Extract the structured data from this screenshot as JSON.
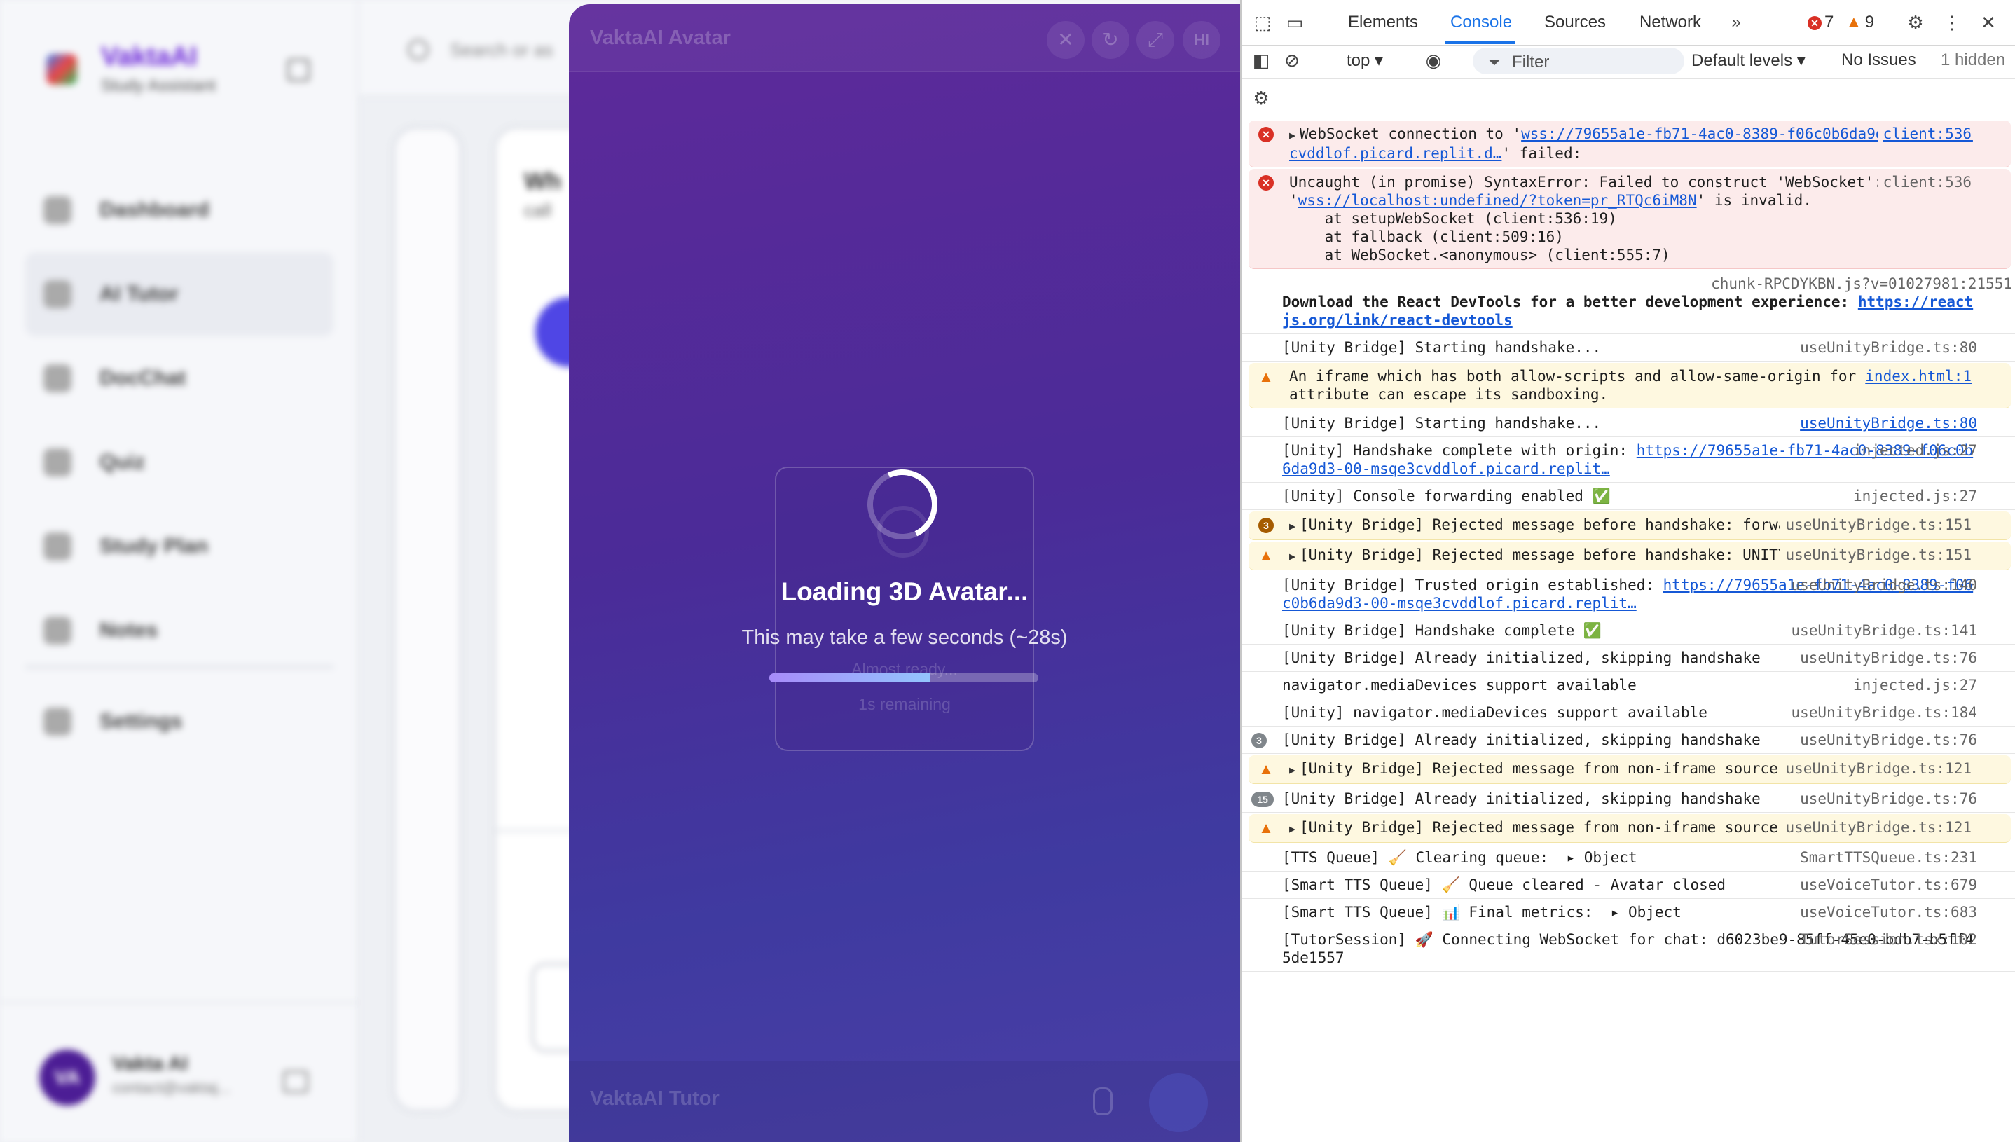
{
  "app": {
    "brand_name": "VaktaAI",
    "brand_sub": "Study Assistant",
    "nav": [
      {
        "label": "Dashboard",
        "icon": "home-icon"
      },
      {
        "label": "AI Tutor",
        "icon": "graduation-cap-icon"
      },
      {
        "label": "DocChat",
        "icon": "document-icon"
      },
      {
        "label": "Quiz",
        "icon": "quiz-icon"
      },
      {
        "label": "Study Plan",
        "icon": "calendar-icon"
      },
      {
        "label": "Notes",
        "icon": "notes-icon"
      }
    ],
    "settings_label": "Settings",
    "search_placeholder": "Search or as",
    "user_initials": "VA",
    "user_name": "Vakta AI",
    "user_email": "contact@vaktaj...",
    "panel_title": "Wh",
    "panel_subtitle": "call"
  },
  "avatar_modal": {
    "title": "VaktaAI Avatar",
    "header_button_text": "HI",
    "loading_title": "Loading 3D Avatar...",
    "loading_sub": "This may take a few seconds (~28s)",
    "ghost_ready": "Almost ready...",
    "ghost_remaining": "1s remaining",
    "progress_fraction": 0.6,
    "footer_label": "VaktaAI Tutor"
  },
  "devtools": {
    "tabs": [
      "Elements",
      "Console",
      "Sources",
      "Network"
    ],
    "active_tab": "Console",
    "error_count": "7",
    "warning_count": "9",
    "context": "top",
    "filter_placeholder": "Filter",
    "levels": "Default levels",
    "issues": "No Issues",
    "hidden": "1 hidden",
    "messages": [
      {
        "level": "error",
        "text": "WebSocket connection to 'wss://79655a1e-fb71-4ac0-8389-f06c0b6da9d3-00-msqe3cvddlof.picard.replit.d…' failed:",
        "source": "client:536",
        "source_link": true
      },
      {
        "level": "error",
        "text": "Uncaught (in promise) SyntaxError: Failed to construct 'WebSocket': The URL 'wss://localhost:undefined/?token=pr_RTQc6iM8N' is invalid.\n    at setupWebSocket (client:536:19)\n    at fallback (client:509:16)\n    at WebSocket.<anonymous> (client:555:7)",
        "source": "client:536",
        "source_link": false
      },
      {
        "level": "info",
        "text": "Download the React DevTools for a better development experience: https://reactjs.org/link/react-devtools",
        "source": "chunk-RPCDYKBN.js?v=01027981:21551",
        "source_link": false
      },
      {
        "level": "info",
        "text": "[Unity Bridge] Starting handshake...",
        "source": "useUnityBridge.ts:80",
        "source_link": false
      },
      {
        "level": "warn",
        "text": "An iframe which has both allow-scripts and allow-same-origin for its sandbox attribute can escape its sandboxing.",
        "source": "index.html:1",
        "source_link": true
      },
      {
        "level": "info",
        "text": "[Unity Bridge] Starting handshake...",
        "source": "useUnityBridge.ts:80",
        "source_link": true
      },
      {
        "level": "info",
        "text": "[Unity] Handshake complete with origin: https://79655a1e-fb71-4ac0-8389-f06c0b6da9d3-00-msqe3cvddlof.picard.replit…",
        "source": "injected.js:27",
        "source_link": false
      },
      {
        "level": "info",
        "text": "[Unity] Console forwarding enabled ✅",
        "source": "injected.js:27",
        "source_link": false
      },
      {
        "level": "warn-count",
        "count": "3",
        "text": "[Unity Bridge] Rejected message before handshake: forward-log",
        "source": "useUnityBridge.ts:151",
        "source_link": false
      },
      {
        "level": "warn",
        "text": "[Unity Bridge] Rejected message before handshake: UNITY_LOG",
        "source": "useUnityBridge.ts:151",
        "source_link": false
      },
      {
        "level": "info",
        "text": "[Unity Bridge] Trusted origin established: https://79655a1e-fb71-4ac0-8389-f06c0b6da9d3-00-msqe3cvddlof.picard.replit…",
        "source": "useUnityBridge.ts:140",
        "source_link": false
      },
      {
        "level": "info",
        "text": "[Unity Bridge] Handshake complete ✅",
        "source": "useUnityBridge.ts:141",
        "source_link": false
      },
      {
        "level": "info",
        "text": "[Unity Bridge] Already initialized, skipping handshake",
        "source": "useUnityBridge.ts:76",
        "source_link": false
      },
      {
        "level": "info",
        "text": "navigator.mediaDevices support available",
        "source": "injected.js:27",
        "source_link": false
      },
      {
        "level": "info",
        "text": "[Unity] navigator.mediaDevices support available",
        "source": "useUnityBridge.ts:184",
        "source_link": false
      },
      {
        "level": "info-count",
        "count": "3",
        "text": "[Unity Bridge] Already initialized, skipping handshake",
        "source": "useUnityBridge.ts:76",
        "source_link": false
      },
      {
        "level": "warn",
        "text": "[Unity Bridge] Rejected message from non-iframe source",
        "source": "useUnityBridge.ts:121",
        "source_link": false
      },
      {
        "level": "info-count",
        "count": "15",
        "text": "[Unity Bridge] Already initialized, skipping handshake",
        "source": "useUnityBridge.ts:76",
        "source_link": false
      },
      {
        "level": "warn",
        "text": "[Unity Bridge] Rejected message from non-iframe source",
        "source": "useUnityBridge.ts:121",
        "source_link": false
      },
      {
        "level": "info",
        "text": "[TTS Queue] 🧹 Clearing queue:  ▸ Object",
        "source": "SmartTTSQueue.ts:231",
        "source_link": false
      },
      {
        "level": "info",
        "text": "[Smart TTS Queue] 🧹 Queue cleared - Avatar closed",
        "source": "useVoiceTutor.ts:679",
        "source_link": false
      },
      {
        "level": "info",
        "text": "[Smart TTS Queue] 📊 Final metrics:  ▸ Object",
        "source": "useVoiceTutor.ts:683",
        "source_link": false
      },
      {
        "level": "info",
        "text": "[TutorSession] 🚀 Connecting WebSocket for chat: d6023be9-85ff-45e0-bdb7-b5ff45de1557",
        "source": "TutorSession.tsx:102",
        "source_link": false
      }
    ]
  }
}
